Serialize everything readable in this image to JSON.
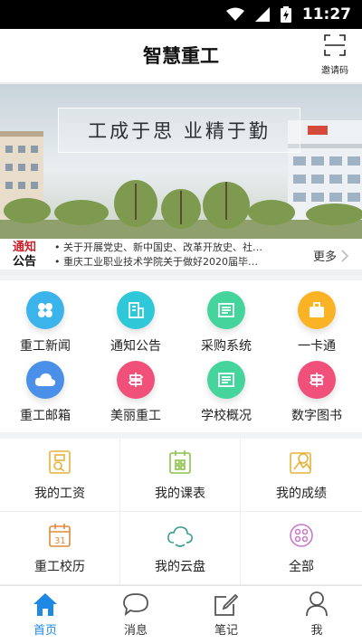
{
  "status_bar": {
    "time": "11:27"
  },
  "app_bar": {
    "title": "智慧重工",
    "invite_label": "邀请码"
  },
  "banner": {
    "slogan": "工成于思  业精于勤"
  },
  "notice": {
    "tag_line1": "通知",
    "tag_line2": "公告",
    "items": [
      "• 关于开展党史、新中国史、改革开放史、社…",
      "• 重庆工业职业技术学院关于做好2020届毕…"
    ],
    "more_label": "更多"
  },
  "quick_grid": [
    {
      "label": "重工新闻",
      "color": "#3bb4ec",
      "icon": "news-icon"
    },
    {
      "label": "通知公告",
      "color": "#2ec8d8",
      "icon": "notice-icon"
    },
    {
      "label": "采购系统",
      "color": "#45d49c",
      "icon": "purchase-icon"
    },
    {
      "label": "一卡通",
      "color": "#fbb326",
      "icon": "card-icon"
    },
    {
      "label": "重工邮箱",
      "color": "#4a90e8",
      "icon": "cloud-mail-icon"
    },
    {
      "label": "美丽重工",
      "color": "#f0507a",
      "icon": "signpost-icon"
    },
    {
      "label": "学校概况",
      "color": "#45d49c",
      "icon": "overview-icon"
    },
    {
      "label": "数字图书",
      "color": "#f0507a",
      "icon": "library-icon"
    }
  ],
  "service_grid": [
    {
      "label": "我的工资",
      "icon": "salary-icon",
      "color": "#e6b23a"
    },
    {
      "label": "我的课表",
      "icon": "schedule-icon",
      "color": "#8bc34a"
    },
    {
      "label": "我的成绩",
      "icon": "grades-icon",
      "color": "#e6b23a"
    },
    {
      "label": "重工校历",
      "icon": "calendar-icon",
      "color": "#e08a3c"
    },
    {
      "label": "我的云盘",
      "icon": "cloud-disk-icon",
      "color": "#3a9e8e"
    },
    {
      "label": "全部",
      "icon": "all-icon",
      "color": "#c77bc9"
    }
  ],
  "tab_bar": [
    {
      "label": "首页",
      "icon": "home-icon",
      "active": true
    },
    {
      "label": "消息",
      "icon": "message-icon",
      "active": false
    },
    {
      "label": "笔记",
      "icon": "note-icon",
      "active": false
    },
    {
      "label": "我",
      "icon": "profile-icon",
      "active": false
    }
  ],
  "colors": {
    "accent": "#1e88e5",
    "notice_red": "#c8232c"
  }
}
